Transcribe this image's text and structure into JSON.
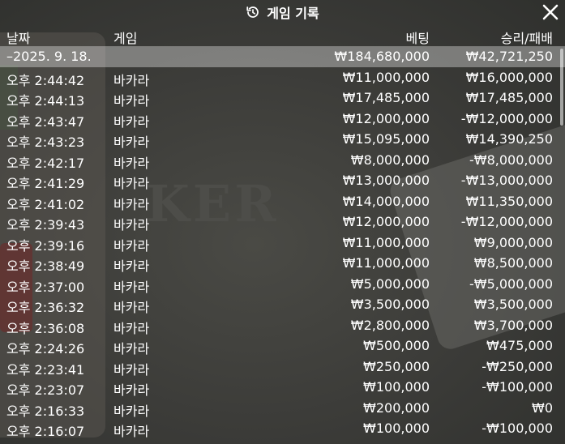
{
  "title": "게임 기록",
  "columns": {
    "date": "날짜",
    "game": "게임",
    "bet": "베팅",
    "result": "승리/패배"
  },
  "summary": {
    "date": "–2025. 9. 18.",
    "bet": "₩184,680,000",
    "result": "₩42,721,250"
  },
  "rows": [
    {
      "time": "오후 2:44:42",
      "game": "바카라",
      "bet": "₩11,000,000",
      "result": "₩16,000,000"
    },
    {
      "time": "오후 2:44:13",
      "game": "바카라",
      "bet": "₩17,485,000",
      "result": "₩17,485,000"
    },
    {
      "time": "오후 2:43:47",
      "game": "바카라",
      "bet": "₩12,000,000",
      "result": "-₩12,000,000"
    },
    {
      "time": "오후 2:43:23",
      "game": "바카라",
      "bet": "₩15,095,000",
      "result": "₩14,390,250"
    },
    {
      "time": "오후 2:42:17",
      "game": "바카라",
      "bet": "₩8,000,000",
      "result": "-₩8,000,000"
    },
    {
      "time": "오후 2:41:29",
      "game": "바카라",
      "bet": "₩13,000,000",
      "result": "-₩13,000,000"
    },
    {
      "time": "오후 2:41:02",
      "game": "바카라",
      "bet": "₩14,000,000",
      "result": "₩11,350,000"
    },
    {
      "time": "오후 2:39:43",
      "game": "바카라",
      "bet": "₩12,000,000",
      "result": "-₩12,000,000"
    },
    {
      "time": "오후 2:39:16",
      "game": "바카라",
      "bet": "₩11,000,000",
      "result": "₩9,000,000"
    },
    {
      "time": "오후 2:38:49",
      "game": "바카라",
      "bet": "₩11,000,000",
      "result": "₩8,500,000"
    },
    {
      "time": "오후 2:37:00",
      "game": "바카라",
      "bet": "₩5,000,000",
      "result": "-₩5,000,000"
    },
    {
      "time": "오후 2:36:32",
      "game": "바카라",
      "bet": "₩3,500,000",
      "result": "₩3,500,000"
    },
    {
      "time": "오후 2:36:08",
      "game": "바카라",
      "bet": "₩2,800,000",
      "result": "₩3,700,000"
    },
    {
      "time": "오후 2:24:26",
      "game": "바카라",
      "bet": "₩500,000",
      "result": "₩475,000"
    },
    {
      "time": "오후 2:23:41",
      "game": "바카라",
      "bet": "₩250,000",
      "result": "-₩250,000"
    },
    {
      "time": "오후 2:23:07",
      "game": "바카라",
      "bet": "₩100,000",
      "result": "-₩100,000"
    },
    {
      "time": "오후 2:16:33",
      "game": "바카라",
      "bet": "₩200,000",
      "result": "₩0"
    },
    {
      "time": "오후 2:16:07",
      "game": "바카라",
      "bet": "₩100,000",
      "result": "-₩100,000"
    }
  ],
  "background_word": "KER"
}
